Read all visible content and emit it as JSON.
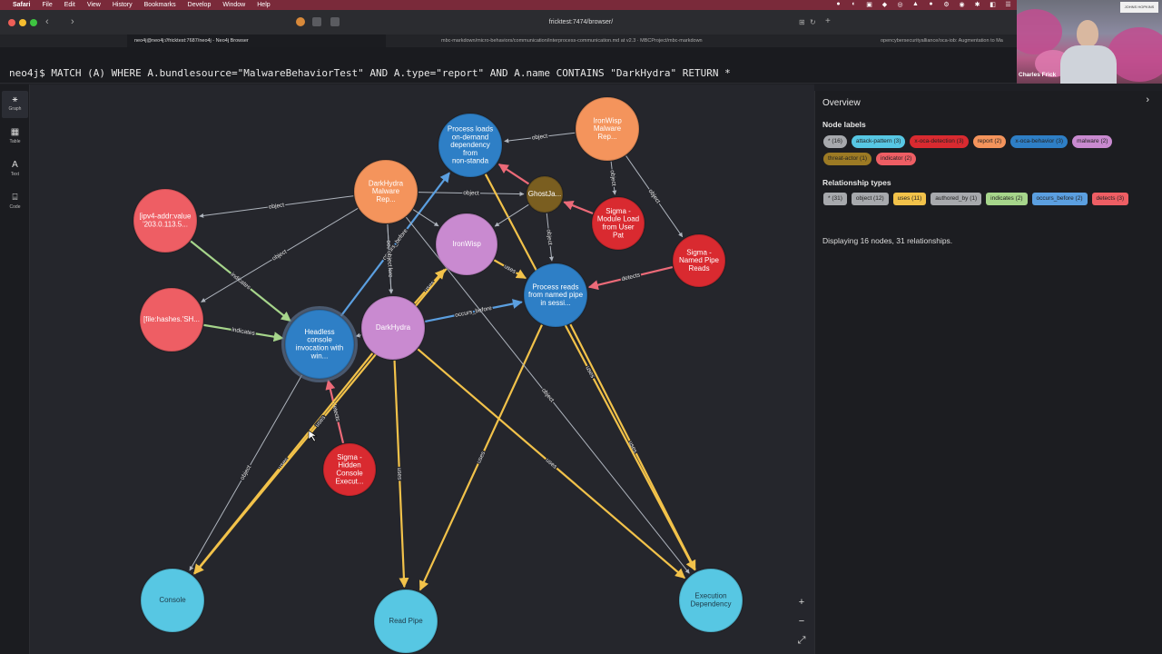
{
  "menubar": {
    "app": "Safari",
    "items": [
      "File",
      "Edit",
      "View",
      "History",
      "Bookmarks",
      "Develop",
      "Window",
      "Help"
    ]
  },
  "browser": {
    "url": "fricktest:7474/browser/",
    "tabs": [
      "neo4j@neo4j://fricktest:7687/neo4j - Neo4j Browser",
      "mbc-markdown/micro-behaviors/communication/interprocess-communication.md at v2.3 · MBCProject/mbc-markdown",
      "opencybersecurityalliance/oca-iob: Augmentation to Ma"
    ]
  },
  "webcam": {
    "name": "Charles Frick"
  },
  "command": "neo4j$ MATCH (A) WHERE A.bundlesource=\"MalwareBehaviorTest\" AND A.type=\"report\" AND A.name CONTAINS \"DarkHydra\" RETURN *",
  "sidebar": [
    {
      "label": "Graph",
      "icon": "graph-icon"
    },
    {
      "label": "Table",
      "icon": "table-icon"
    },
    {
      "label": "Text",
      "icon": "text-icon"
    },
    {
      "label": "Code",
      "icon": "code-icon"
    }
  ],
  "graph": {
    "nodes": [
      {
        "id": "pl",
        "text": [
          "Process loads",
          "on-demand",
          "dependency",
          "from",
          "non-standa"
        ],
        "color": "#2e7fc6",
        "textColor": "#ffffff"
      },
      {
        "id": "iwr",
        "text": [
          "IronWisp",
          "Malware",
          "Rep..."
        ],
        "color": "#f4945c",
        "textColor": "#ffffff"
      },
      {
        "id": "dhr",
        "text": [
          "DarkHydra",
          "Malware",
          "Rep..."
        ],
        "color": "#f4945c",
        "textColor": "#ffffff"
      },
      {
        "id": "gj",
        "text": [
          "GhostJa..."
        ],
        "color": "#7a5e20",
        "textColor": "#ffffff"
      },
      {
        "id": "iw",
        "text": [
          "IronWisp"
        ],
        "color": "#c98ad0",
        "textColor": "#ffffff"
      },
      {
        "id": "ip",
        "text": [
          "[ipv4-addr:value",
          "'203.0.113.5..."
        ],
        "color": "#ee5e64",
        "textColor": "#ffffff"
      },
      {
        "id": "ml",
        "text": [
          "Sigma -",
          "Module Load",
          "from User",
          "Pat"
        ],
        "color": "#d92a30",
        "textColor": "#ffffff"
      },
      {
        "id": "np",
        "text": [
          "Sigma -",
          "Named Pipe",
          "Reads"
        ],
        "color": "#d92a30",
        "textColor": "#ffffff"
      },
      {
        "id": "pr",
        "text": [
          "Process reads",
          "from named pipe",
          "in sessi..."
        ],
        "color": "#2e7fc6",
        "textColor": "#ffffff"
      },
      {
        "id": "fh",
        "text": [
          "[file:hashes.'SH..."
        ],
        "color": "#ee5e64",
        "textColor": "#ffffff"
      },
      {
        "id": "hc",
        "text": [
          "Headless",
          "console",
          "invocation with",
          "win..."
        ],
        "color": "#2e7fc6",
        "textColor": "#ffffff"
      },
      {
        "id": "dh",
        "text": [
          "DarkHydra"
        ],
        "color": "#c98ad0",
        "textColor": "#ffffff"
      },
      {
        "id": "sh",
        "text": [
          "Sigma -",
          "Hidden",
          "Console",
          "Execut..."
        ],
        "color": "#d92a30",
        "textColor": "#ffffff"
      },
      {
        "id": "con",
        "text": [
          "Console"
        ],
        "color": "#57c7e3",
        "textColor": "#1e3a48"
      },
      {
        "id": "rp",
        "text": [
          "Read Pipe"
        ],
        "color": "#57c7e3",
        "textColor": "#1e3a48"
      },
      {
        "id": "ed",
        "text": [
          "Execution",
          "Dependency"
        ],
        "color": "#57c7e3",
        "textColor": "#1e3a48"
      }
    ],
    "edges": [
      {
        "from": "iwr",
        "to": "pl",
        "label": "object",
        "color": "#aeb4bd"
      },
      {
        "from": "dhr",
        "to": "ip",
        "label": "object",
        "color": "#aeb4bd"
      },
      {
        "from": "dhr",
        "to": "gj",
        "label": "object",
        "color": "#aeb4bd"
      },
      {
        "from": "ml",
        "to": "gj",
        "label": "",
        "color": "#ec6a78"
      },
      {
        "from": "gj",
        "to": "pl",
        "label": "",
        "color": "#ec6a78"
      },
      {
        "from": "iwr",
        "to": "ml",
        "label": "object",
        "color": "#aeb4bd"
      },
      {
        "from": "iwr",
        "to": "np",
        "label": "object",
        "color": "#aeb4bd"
      },
      {
        "from": "ip",
        "to": "hc",
        "label": "indicates",
        "color": "#a6d58b"
      },
      {
        "from": "fh",
        "to": "hc",
        "label": "indicates",
        "color": "#a6d58b"
      },
      {
        "from": "dhr",
        "to": "fh",
        "label": "object",
        "color": "#aeb4bd"
      },
      {
        "from": "np",
        "to": "pr",
        "label": "detects",
        "color": "#ec6a78"
      },
      {
        "from": "iw",
        "to": "pr",
        "label": "uses",
        "color": "#f2c24a"
      },
      {
        "from": "dh",
        "to": "pr",
        "label": "occurs_before",
        "color": "#5b9fe0"
      },
      {
        "from": "dhr",
        "to": "dh",
        "label": "occurs_before",
        "color": "#aeb4bd"
      },
      {
        "from": "hc",
        "to": "pl",
        "label": "occurs_before",
        "color": "#5b9fe0"
      },
      {
        "from": "dh",
        "to": "iw",
        "label": "uses",
        "color": "#f2c24a"
      },
      {
        "from": "sh",
        "to": "hc",
        "label": "detects",
        "color": "#ec6a78"
      },
      {
        "from": "hc",
        "to": "con",
        "label": "object",
        "color": "#aeb4bd"
      },
      {
        "from": "dh",
        "to": "con",
        "label": "uses",
        "color": "#f2c24a"
      },
      {
        "from": "iw",
        "to": "con",
        "label": "uses",
        "color": "#f2c24a"
      },
      {
        "from": "dh",
        "to": "rp",
        "label": "uses",
        "color": "#f2c24a"
      },
      {
        "from": "pr",
        "to": "rp",
        "label": "uses",
        "color": "#f2c24a"
      },
      {
        "from": "dh",
        "to": "ed",
        "label": "uses",
        "color": "#f2c24a"
      },
      {
        "from": "pr",
        "to": "ed",
        "label": "uses",
        "color": "#f2c24a"
      },
      {
        "from": "dhr",
        "to": "ed",
        "label": "object",
        "color": "#aeb4bd"
      },
      {
        "from": "pl",
        "to": "ed",
        "label": "uses",
        "color": "#f2c24a"
      },
      {
        "from": "dhr",
        "to": "dh",
        "label": "object",
        "color": "#aeb4bd"
      },
      {
        "from": "dh",
        "to": "hc",
        "label": "",
        "color": "#aeb4bd"
      },
      {
        "from": "dhr",
        "to": "iw",
        "label": "",
        "color": "#aeb4bd"
      },
      {
        "from": "gj",
        "to": "iw",
        "label": "",
        "color": "#aeb4bd"
      },
      {
        "from": "gj",
        "to": "pr",
        "label": "object",
        "color": "#aeb4bd"
      }
    ]
  },
  "zoom": {
    "in": "+",
    "out": "−",
    "fit": "⤢"
  },
  "overview": {
    "title": "Overview",
    "node_labels_title": "Node labels",
    "node_labels": [
      {
        "text": "* (16)",
        "color": "#a7a9ad"
      },
      {
        "text": "attack-pattern (3)",
        "color": "#57c7e3"
      },
      {
        "text": "x-oca-detection (3)",
        "color": "#d92a30"
      },
      {
        "text": "report (2)",
        "color": "#f4945c"
      },
      {
        "text": "x-oca-behavior (3)",
        "color": "#2e7fc6"
      },
      {
        "text": "malware (2)",
        "color": "#c98ad0"
      },
      {
        "text": "threat-actor (1)",
        "color": "#9c7a24"
      },
      {
        "text": "indicator (2)",
        "color": "#ee5e64"
      }
    ],
    "rel_types_title": "Relationship types",
    "rel_types": [
      {
        "text": "* (31)",
        "color": "#a7a9ad"
      },
      {
        "text": "object (12)",
        "color": "#a7a9ad"
      },
      {
        "text": "uses (11)",
        "color": "#f2c24a"
      },
      {
        "text": "authored_by (1)",
        "color": "#a7a9ad"
      },
      {
        "text": "indicates (2)",
        "color": "#a6d58b"
      },
      {
        "text": "occurs_before (2)",
        "color": "#5b9fe0"
      },
      {
        "text": "detects (3)",
        "color": "#ee5e64"
      }
    ],
    "status": "Displaying 16 nodes, 31 relationships."
  }
}
